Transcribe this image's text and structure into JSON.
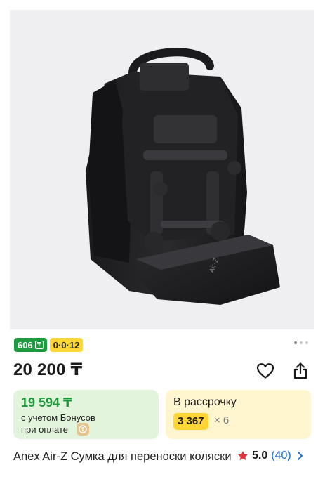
{
  "product": {
    "image_alt": "Anex Air-Z travel bag",
    "image_brand_mark": "Air-Z",
    "bonus_badge": "606",
    "bonus_badge_currency": "₸",
    "installment_badge": "0·0·12",
    "gallery_dots": 3,
    "gallery_active_dot": 0,
    "price": "20 200 ₸",
    "bonus_card": {
      "price": "19 594 ₸",
      "line1": "с учетом Бонусов",
      "line2": "при оплате"
    },
    "installment_card": {
      "title": "В рассрочку",
      "amount": "3 367",
      "multiplier": "× 6"
    },
    "title": "Anex Air-Z Сумка для переноски коляски",
    "rating": {
      "value": "5.0",
      "count": "(40)"
    }
  },
  "icons": {
    "favorite": "heart-icon",
    "share": "share-icon",
    "star": "star-icon",
    "chevron": "chevron-right-icon",
    "pay": "kaspi-pay-icon"
  },
  "colors": {
    "bonus_green": "#1f9b3f",
    "installment_yellow": "#ffd633",
    "link_blue": "#1f6fd6",
    "star_red": "#e3343a"
  }
}
